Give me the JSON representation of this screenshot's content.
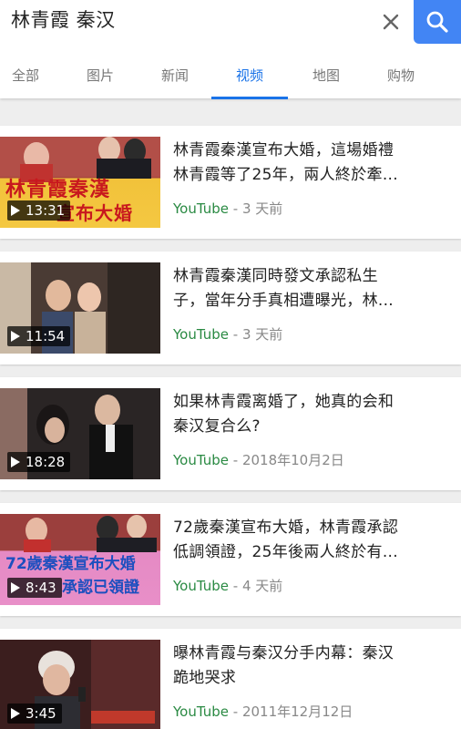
{
  "search": {
    "query": "林青霞 秦汉"
  },
  "tabs": [
    {
      "label": "全部",
      "active": false
    },
    {
      "label": "图片",
      "active": false
    },
    {
      "label": "新闻",
      "active": false
    },
    {
      "label": "视频",
      "active": true
    },
    {
      "label": "地图",
      "active": false
    },
    {
      "label": "购物",
      "active": false
    }
  ],
  "colors": {
    "accent": "#1a73e8",
    "search_button": "#4285f4",
    "source_green": "#2a8a43"
  },
  "results": [
    {
      "title_line1": "林青霞秦漢宣布大婚，這場婚禮",
      "title_line2": "林青霞等了25年，兩人終於牽...",
      "source": "YouTube",
      "separator": " - ",
      "date": "3 天前",
      "duration": "13:31",
      "thumb_caption_1": "林青霞秦漢",
      "thumb_caption_2": "宣布大婚"
    },
    {
      "title_line1": "林青霞秦漢同時發文承認私生",
      "title_line2": "子，當年分手真相遭曝光，林...",
      "source": "YouTube",
      "separator": " - ",
      "date": "3 天前",
      "duration": "11:54"
    },
    {
      "title_line1": "如果林青霞离婚了，她真的会和",
      "title_line2": "秦汉复合么?",
      "source": "YouTube",
      "separator": " - ",
      "date": "2018年10月2日",
      "duration": "18:28"
    },
    {
      "title_line1": "72歲秦漢宣布大婚，林青霞承認",
      "title_line2": "低調領證，25年後兩人終於有...",
      "source": "YouTube",
      "separator": " - ",
      "date": "4 天前",
      "duration": "8:43",
      "thumb_caption_1": "72歲秦漢宣布大婚",
      "thumb_caption_2": "承認已領證"
    },
    {
      "title_line1": "曝林青霞与秦汉分手内幕：秦汉",
      "title_line2": "跪地哭求",
      "source": "YouTube",
      "separator": " - ",
      "date": "2011年12月12日",
      "duration": "3:45"
    }
  ]
}
